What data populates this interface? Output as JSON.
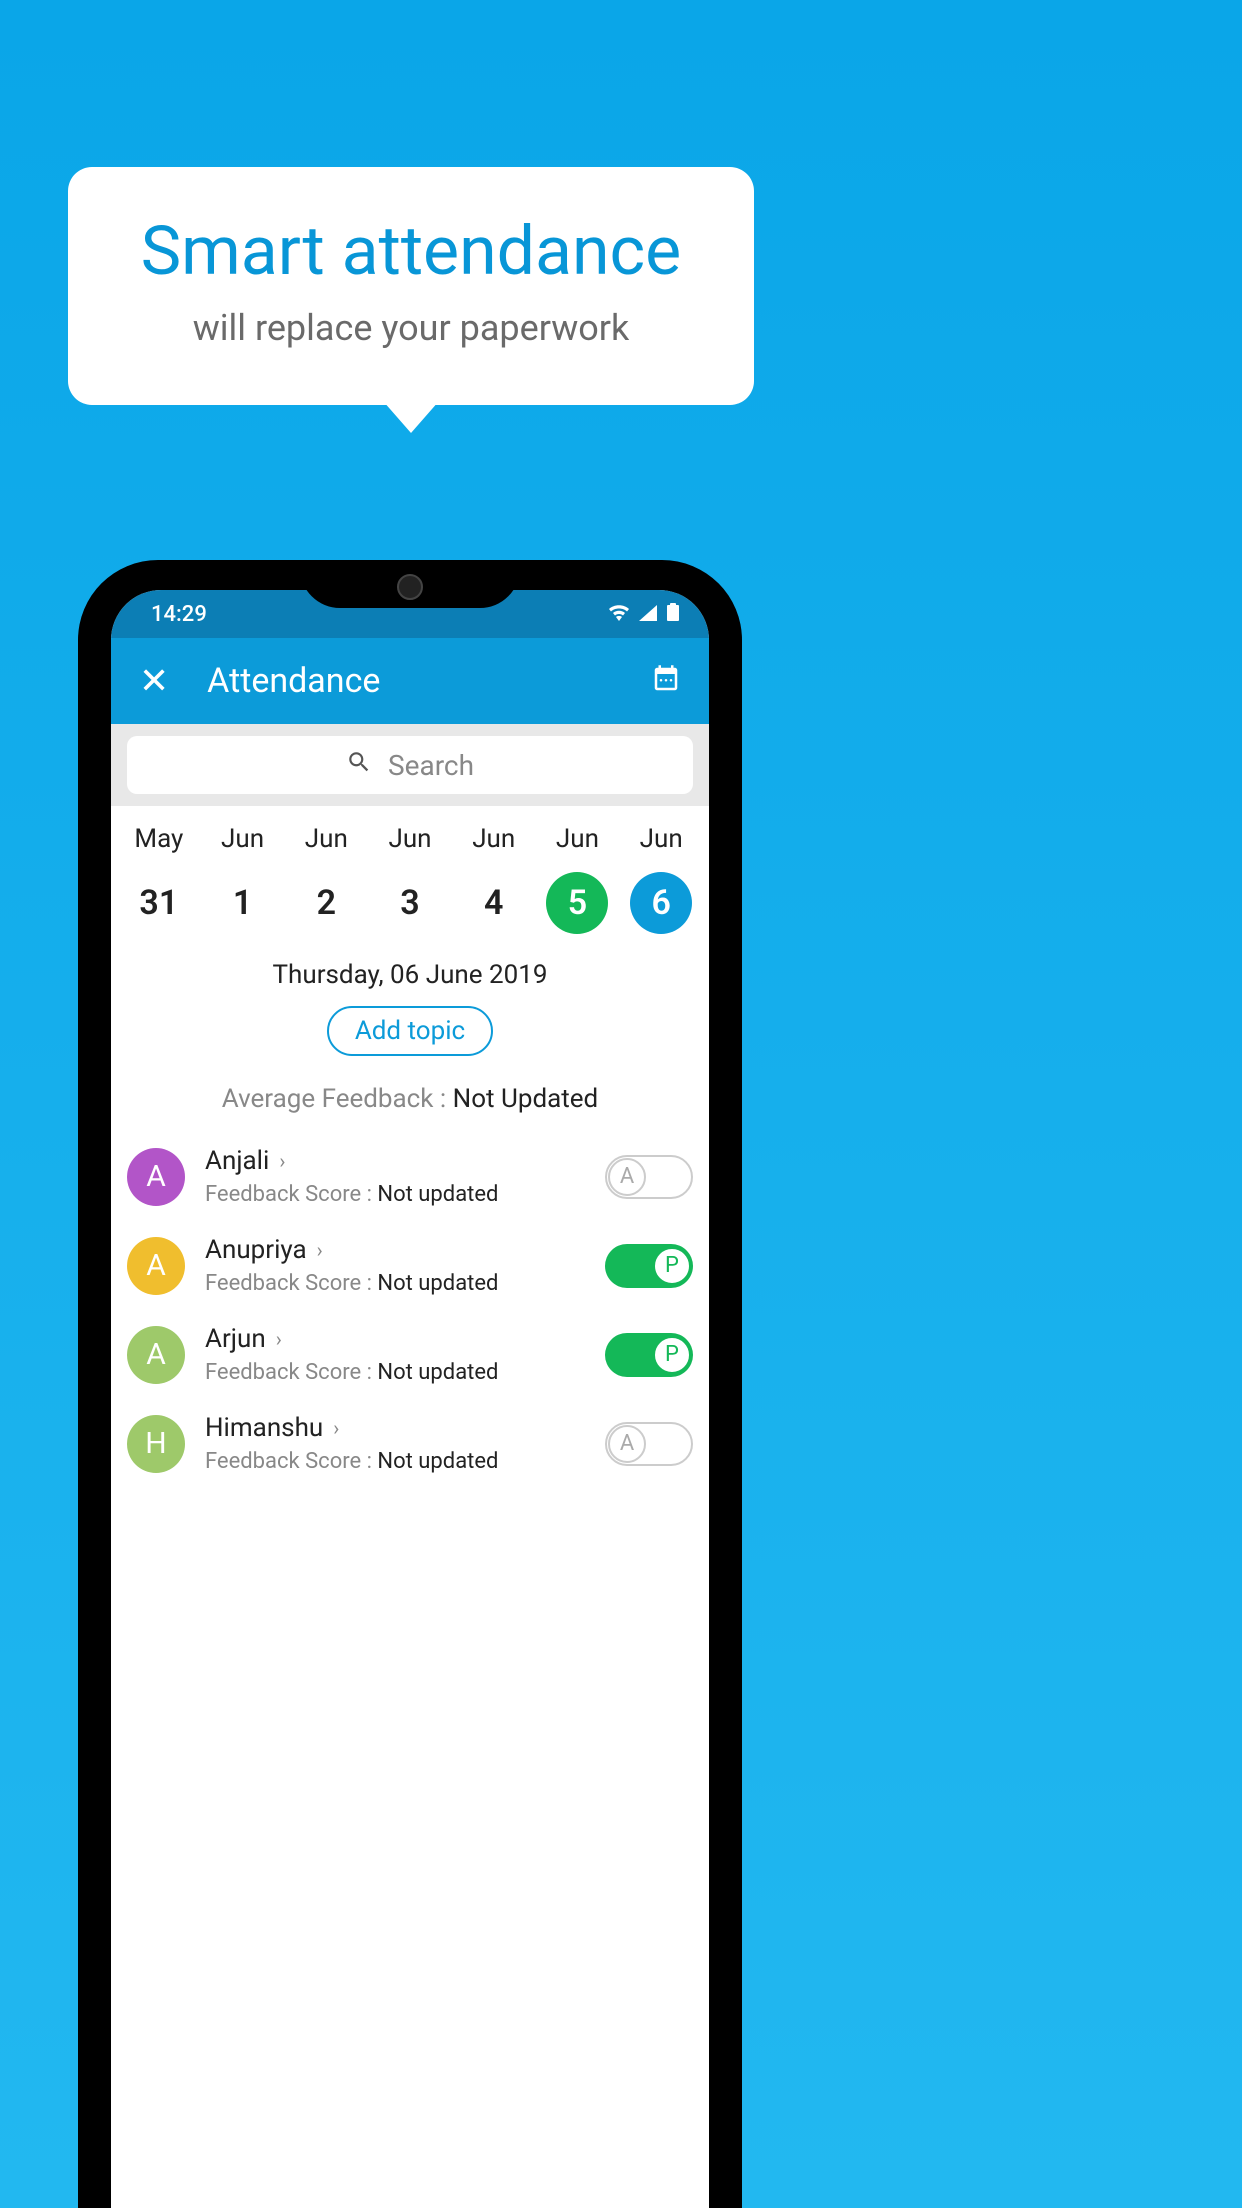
{
  "bubble": {
    "title": "Smart attendance",
    "subtitle": "will replace your paperwork"
  },
  "statusBar": {
    "time": "14:29"
  },
  "appBar": {
    "title": "Attendance"
  },
  "search": {
    "placeholder": "Search"
  },
  "dates": [
    {
      "month": "May",
      "day": "31",
      "style": ""
    },
    {
      "month": "Jun",
      "day": "1",
      "style": ""
    },
    {
      "month": "Jun",
      "day": "2",
      "style": ""
    },
    {
      "month": "Jun",
      "day": "3",
      "style": ""
    },
    {
      "month": "Jun",
      "day": "4",
      "style": ""
    },
    {
      "month": "Jun",
      "day": "5",
      "style": "green"
    },
    {
      "month": "Jun",
      "day": "6",
      "style": "blue"
    }
  ],
  "selectedDate": "Thursday, 06 June 2019",
  "addTopic": "Add topic",
  "avgFeedback": {
    "label": "Average Feedback : ",
    "value": "Not Updated"
  },
  "students": [
    {
      "initial": "A",
      "name": "Anjali",
      "feedbackLabel": "Feedback Score : ",
      "feedbackValue": "Not updated",
      "avatarColor": "#b255c8",
      "status": "absent",
      "statusLetter": "A"
    },
    {
      "initial": "A",
      "name": "Anupriya",
      "feedbackLabel": "Feedback Score : ",
      "feedbackValue": "Not updated",
      "avatarColor": "#f0be2e",
      "status": "present",
      "statusLetter": "P"
    },
    {
      "initial": "A",
      "name": "Arjun",
      "feedbackLabel": "Feedback Score : ",
      "feedbackValue": "Not updated",
      "avatarColor": "#9ec96a",
      "status": "present",
      "statusLetter": "P"
    },
    {
      "initial": "H",
      "name": "Himanshu",
      "feedbackLabel": "Feedback Score : ",
      "feedbackValue": "Not updated",
      "avatarColor": "#9ec96a",
      "status": "absent",
      "statusLetter": "A"
    }
  ]
}
